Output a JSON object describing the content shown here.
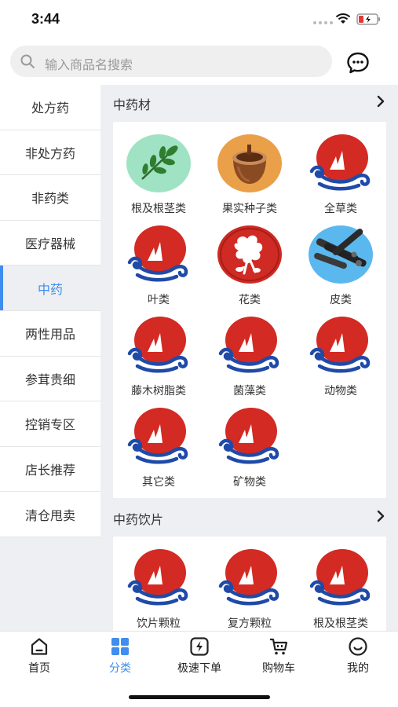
{
  "status_bar": {
    "time": "3:44"
  },
  "search": {
    "placeholder": "输入商品名搜索"
  },
  "sidebar": {
    "items": [
      {
        "label": "处方药"
      },
      {
        "label": "非处方药"
      },
      {
        "label": "非药类"
      },
      {
        "label": "医疗器械"
      },
      {
        "label": "中药",
        "active": true
      },
      {
        "label": "两性用品"
      },
      {
        "label": "参茸贵细"
      },
      {
        "label": "控销专区"
      },
      {
        "label": "店长推荐"
      },
      {
        "label": "清仓甩卖"
      }
    ]
  },
  "sections": [
    {
      "title": "中药材",
      "items": [
        {
          "label": "根及根茎类",
          "icon": "leaf-icon"
        },
        {
          "label": "果实种子类",
          "icon": "acorn-icon"
        },
        {
          "label": "全草类",
          "icon": "brand-logo-icon"
        },
        {
          "label": "叶类",
          "icon": "brand-logo-icon"
        },
        {
          "label": "花类",
          "icon": "cotton-flower-icon"
        },
        {
          "label": "皮类",
          "icon": "bark-icon"
        },
        {
          "label": "藤木树脂类",
          "icon": "brand-logo-icon"
        },
        {
          "label": "菌藻类",
          "icon": "brand-logo-icon"
        },
        {
          "label": "动物类",
          "icon": "brand-logo-icon"
        },
        {
          "label": "其它类",
          "icon": "brand-logo-icon"
        },
        {
          "label": "矿物类",
          "icon": "brand-logo-icon"
        }
      ]
    },
    {
      "title": "中药饮片",
      "items": [
        {
          "label": "饮片颗粒",
          "icon": "brand-logo-icon"
        },
        {
          "label": "复方颗粒",
          "icon": "brand-logo-icon"
        },
        {
          "label": "根及根茎类",
          "icon": "brand-logo-icon"
        }
      ]
    }
  ],
  "tabbar": {
    "items": [
      {
        "label": "首页",
        "icon": "home-icon"
      },
      {
        "label": "分类",
        "icon": "grid-icon",
        "active": true
      },
      {
        "label": "极速下单",
        "icon": "lightning-icon"
      },
      {
        "label": "购物车",
        "icon": "cart-icon"
      },
      {
        "label": "我的",
        "icon": "profile-icon"
      }
    ]
  },
  "colors": {
    "accent": "#3f8dee",
    "logo_red": "#d32a24",
    "logo_blue": "#1f4aa8",
    "background": "#eeeff3"
  }
}
